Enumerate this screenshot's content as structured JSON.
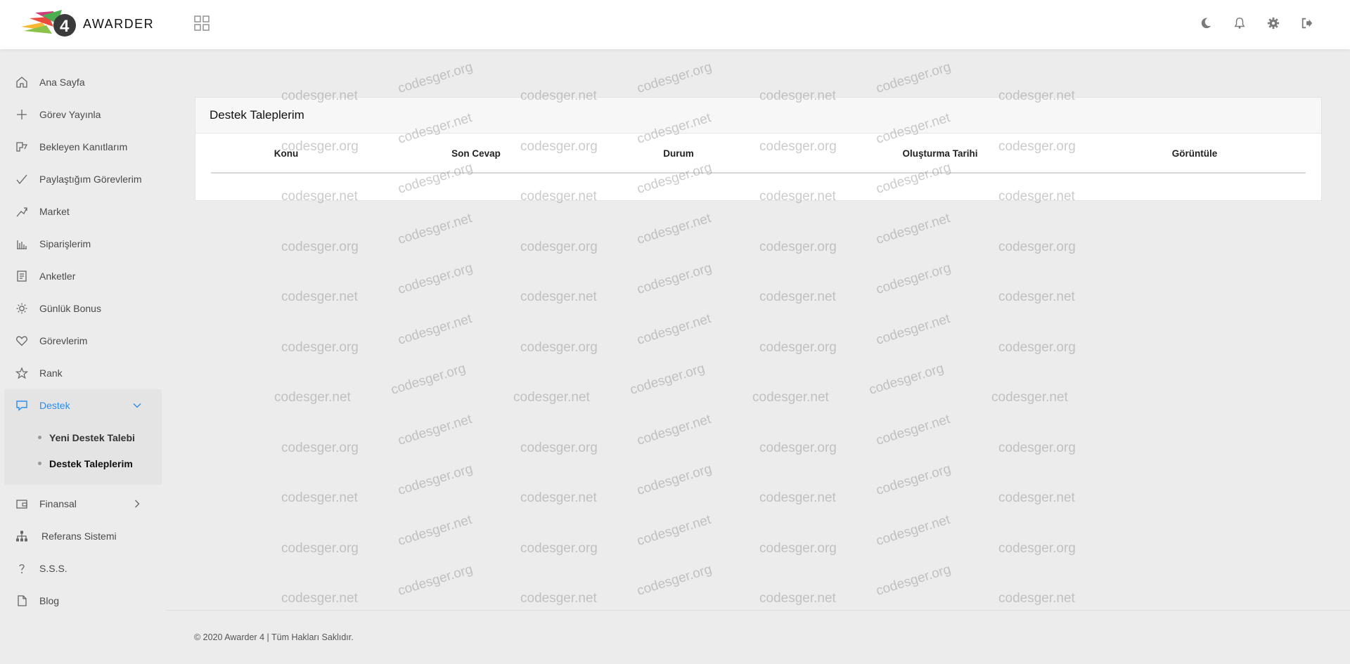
{
  "header": {
    "logo_text": "AWARDER",
    "logo_number": "4",
    "apps_icon": "grid-icon",
    "icons": [
      "moon-icon",
      "bell-icon",
      "gear-icon",
      "logout-icon"
    ]
  },
  "sidebar": {
    "items": [
      {
        "label": "Ana Sayfa",
        "icon": "home-icon"
      },
      {
        "label": "Görev Yayınla",
        "icon": "plus-icon"
      },
      {
        "label": "Bekleyen Kanıtlarım",
        "icon": "proof-icon"
      },
      {
        "label": "Paylaştığım Görevlerim",
        "icon": "check-icon"
      },
      {
        "label": "Market",
        "icon": "market-icon"
      },
      {
        "label": "Siparişlerim",
        "icon": "orders-icon"
      },
      {
        "label": "Anketler",
        "icon": "survey-icon"
      },
      {
        "label": "Günlük Bonus",
        "icon": "sun-icon"
      },
      {
        "label": "Görevlerim",
        "icon": "heart-icon"
      },
      {
        "label": "Rank",
        "icon": "star-icon"
      }
    ],
    "support": {
      "label": "Destek",
      "icon": "chat-icon",
      "children": [
        {
          "label": "Yeni Destek Talebi"
        },
        {
          "label": "Destek Taleplerim"
        }
      ]
    },
    "after": [
      {
        "label": "Finansal",
        "icon": "wallet-icon"
      },
      {
        "label": "Referans Sistemi",
        "icon": "network-icon"
      },
      {
        "label": "S.S.S.",
        "icon": "question-icon"
      },
      {
        "label": "Blog",
        "icon": "file-icon"
      }
    ]
  },
  "main": {
    "card_title": "Destek Taleplerim",
    "columns": [
      "Konu",
      "Son Cevap",
      "Durum",
      "Oluşturma Tarihi",
      "Görüntüle"
    ],
    "rows": []
  },
  "footer": {
    "text": "© 2020 Awarder 4 | Tüm Hakları Saklıdır."
  },
  "watermark": {
    "texts": [
      "codesger.net",
      "codesger.org"
    ]
  },
  "colors": {
    "accent": "#2d8cf0",
    "background": "#ececec"
  }
}
